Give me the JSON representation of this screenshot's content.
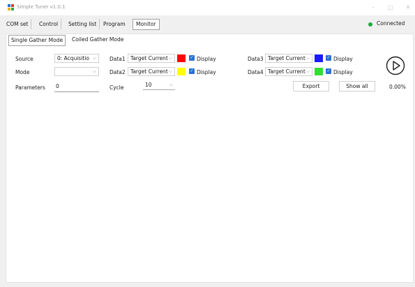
{
  "window": {
    "title": "Simple Tuner v1.0.1",
    "minimize": "–",
    "maximize": "□",
    "close": "✕"
  },
  "menu": {
    "tabs": [
      "COM set",
      "Control",
      "Setting list",
      "Program",
      "Monitor"
    ],
    "active": "Monitor"
  },
  "connection": {
    "status": "Connected",
    "color": "#1faa3c"
  },
  "subtabs": {
    "items": [
      "Single Gather Mode",
      "Coiled Gather Mode"
    ],
    "active": "Single Gather Mode"
  },
  "form": {
    "source_label": "Source",
    "source_value": "0: Acquisitio",
    "mode_label": "Mode",
    "mode_value": "",
    "parameters_label": "Parameters",
    "parameters_value": "0",
    "cycle_label": "Cycle",
    "cycle_value": "10"
  },
  "data_channels": [
    {
      "label": "Data1",
      "value": "Target Current(",
      "color": "#ff0000",
      "display_label": "Display",
      "display_checked": true
    },
    {
      "label": "Data2",
      "value": "Target Current(",
      "color": "#ffff00",
      "display_label": "Display",
      "display_checked": true
    },
    {
      "label": "Data3",
      "value": "Target Current(",
      "color": "#1a1aff",
      "display_label": "Display",
      "display_checked": true
    },
    {
      "label": "Data4",
      "value": "Target Current(",
      "color": "#33dd33",
      "display_label": "Display",
      "display_checked": true
    }
  ],
  "buttons": {
    "export": "Export",
    "show_all": "Show all"
  },
  "progress": {
    "percent_text": "0.00%",
    "value": 0
  },
  "icons": {
    "play": "play-circle-icon",
    "app": "app-icon",
    "chevron": "chevron-down-icon"
  }
}
